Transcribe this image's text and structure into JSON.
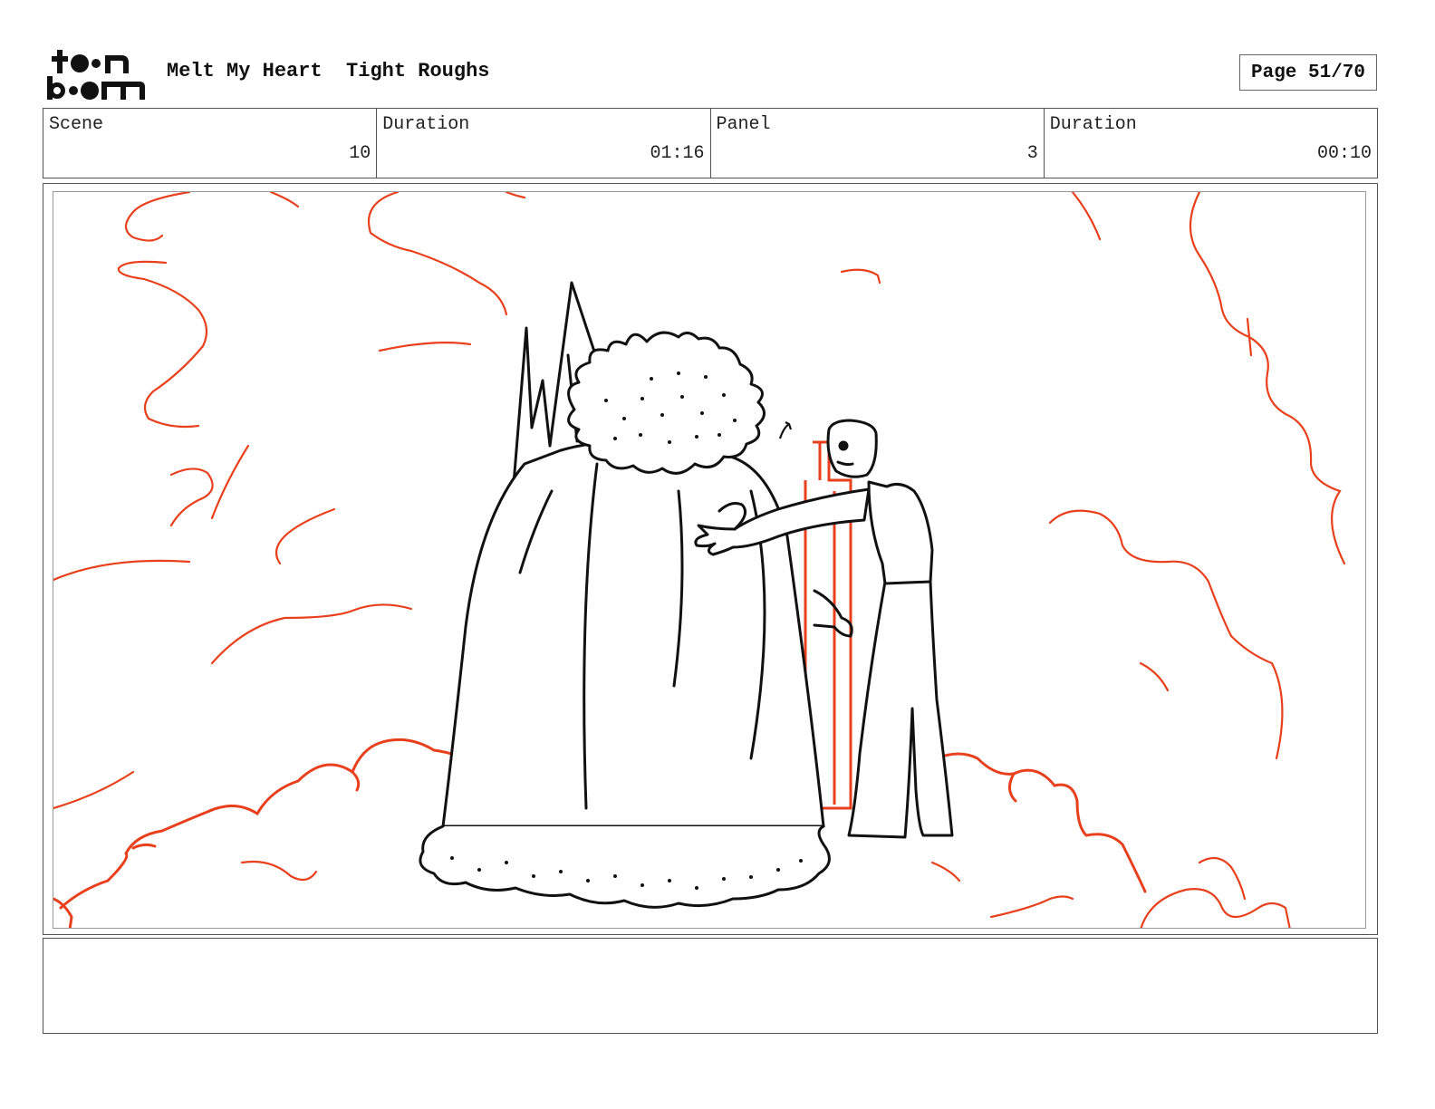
{
  "header": {
    "logo_text": "toon boom",
    "project": "Melt My Heart",
    "stage": "Tight Roughs",
    "page_label": "Page 51/70"
  },
  "info": {
    "scene_label": "Scene",
    "scene_value": "10",
    "scene_duration_label": "Duration",
    "scene_duration_value": "01:16",
    "panel_label": "Panel",
    "panel_value": "3",
    "panel_duration_label": "Duration",
    "panel_duration_value": "00:10"
  },
  "colors": {
    "sketch_red": "#e8401c",
    "line_black": "#111111"
  },
  "notes": ""
}
